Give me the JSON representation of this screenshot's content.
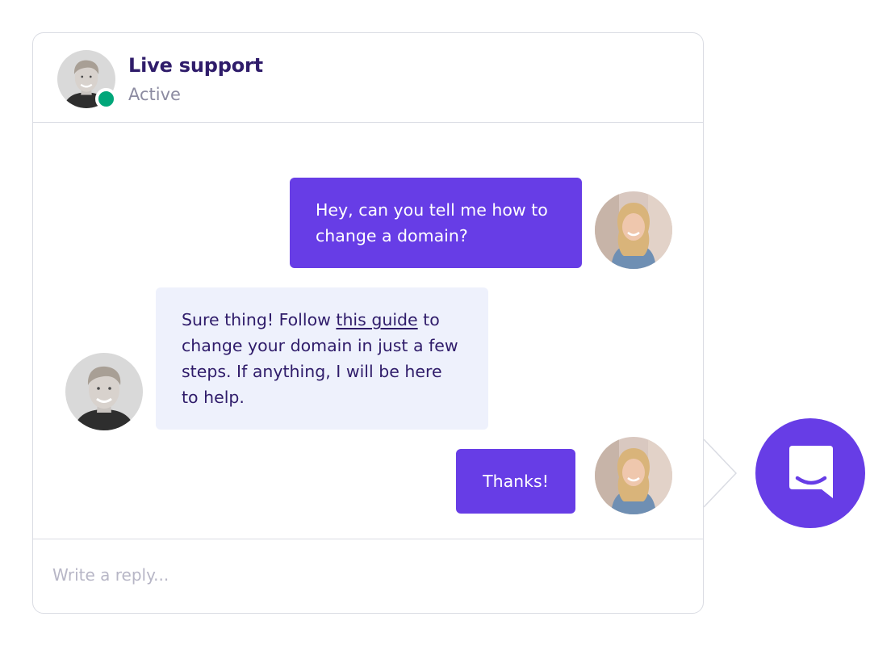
{
  "header": {
    "title": "Live support",
    "status": "Active"
  },
  "messages": [
    {
      "from": "user",
      "text": "Hey, can you tell me how to change a domain?"
    },
    {
      "from": "agent",
      "text_before": "Sure thing! Follow ",
      "link_text": "this guide",
      "text_after": " to change your domain in just a few steps. If anything, I will be here to help."
    },
    {
      "from": "user",
      "text": "Thanks!"
    }
  ],
  "reply": {
    "placeholder": "Write a reply..."
  },
  "colors": {
    "accent": "#673de6",
    "title": "#2f1c6a",
    "online": "#00a679",
    "agent_bubble": "#eef1fc"
  },
  "icons": {
    "launcher": "chat-bubble-smile-icon",
    "status": "online-status-dot"
  }
}
